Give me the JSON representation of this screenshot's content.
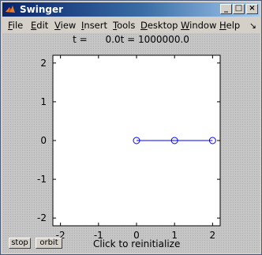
{
  "window": {
    "title": "Swinger"
  },
  "menu": [
    {
      "label": "File",
      "key": "F",
      "rest": "ile"
    },
    {
      "label": "Edit",
      "key": "E",
      "rest": "dit"
    },
    {
      "label": "View",
      "key": "V",
      "rest": "iew"
    },
    {
      "label": "Insert",
      "key": "I",
      "rest": "nsert"
    },
    {
      "label": "Tools",
      "key": "T",
      "rest": "ools"
    },
    {
      "label": "Desktop",
      "key": "D",
      "rest": "esktop"
    },
    {
      "label": "Window",
      "key": "W",
      "rest": "indow"
    },
    {
      "label": "Help",
      "key": "H",
      "rest": "elp"
    }
  ],
  "plot_title": "t =      0.0t = 1000000.0",
  "axes": {
    "x_ticks": [
      "-2",
      "-1",
      "0",
      "1",
      "2"
    ],
    "y_ticks": [
      "2",
      "1",
      "0",
      "-1",
      "-2"
    ],
    "xlim": [
      -2.2,
      2.2
    ],
    "ylim": [
      -2.2,
      2.2
    ]
  },
  "chart_data": {
    "type": "line",
    "x": [
      0,
      1,
      2
    ],
    "y": [
      0,
      0,
      0
    ],
    "color": "#0000ff",
    "marker": "circle"
  },
  "controls": {
    "stop_label": "stop",
    "orbit_label": "orbit",
    "status": "Click to reinitialize"
  },
  "colors": {
    "line": "#0000ff",
    "axes_bg": "#ffffff"
  }
}
